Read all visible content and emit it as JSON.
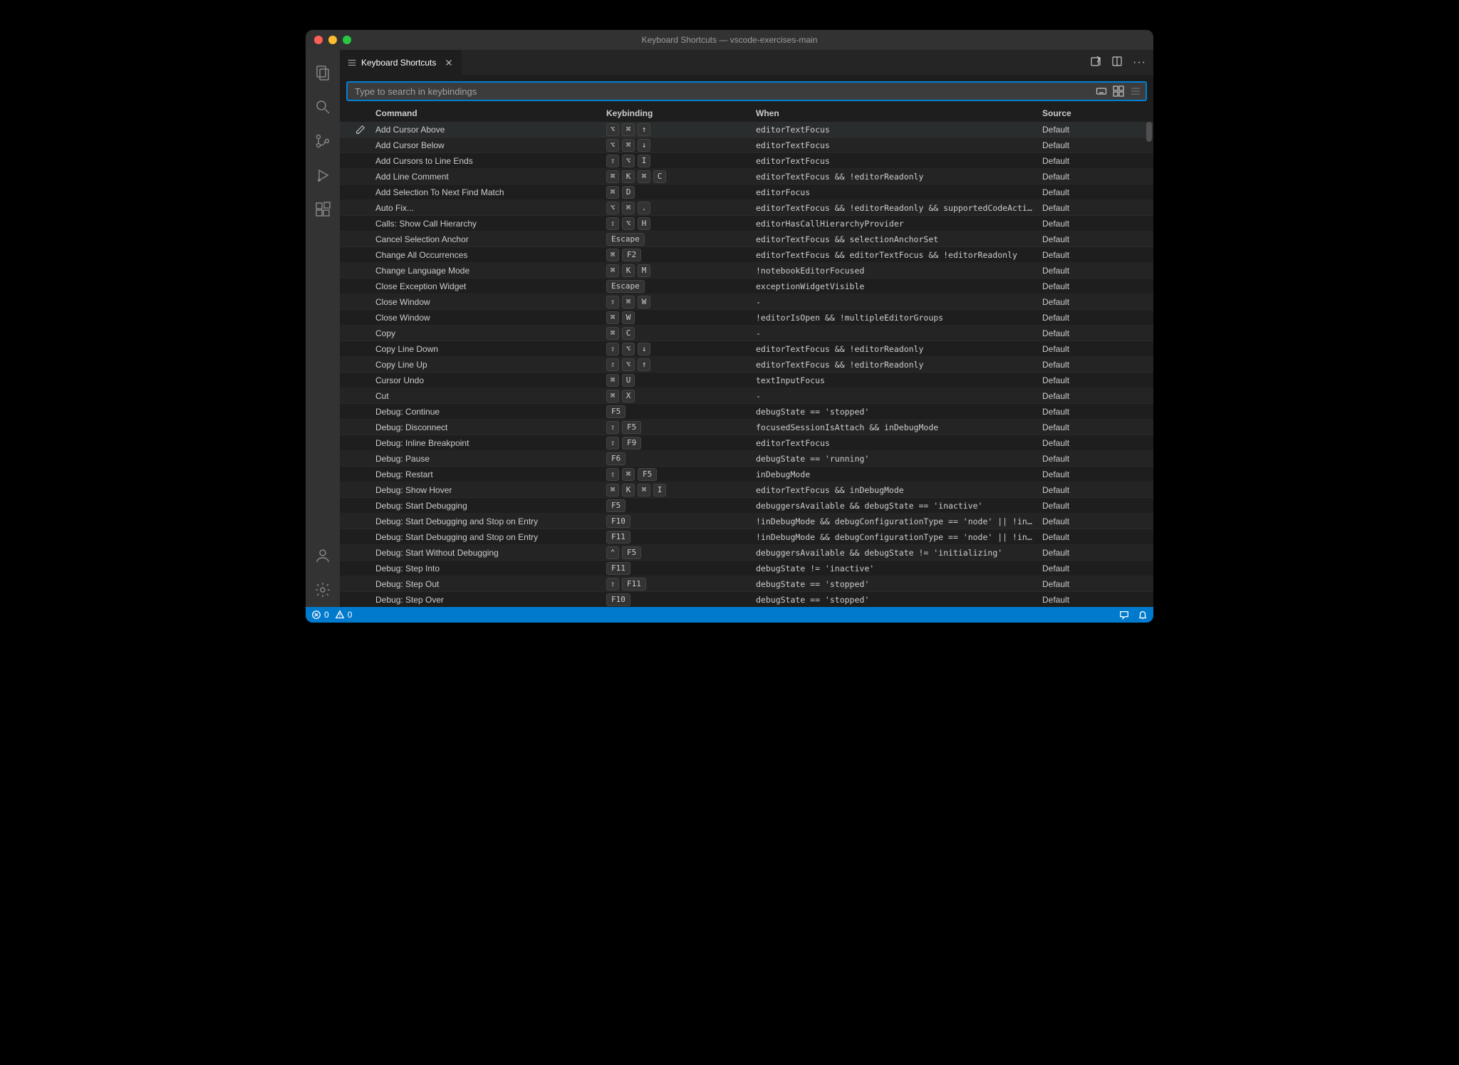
{
  "titlebar": {
    "title": "Keyboard Shortcuts — vscode-exercises-main"
  },
  "tab": {
    "label": "Keyboard Shortcuts"
  },
  "search": {
    "placeholder": "Type to search in keybindings"
  },
  "headers": {
    "command": "Command",
    "keybinding": "Keybinding",
    "when": "When",
    "source": "Source"
  },
  "statusbar": {
    "errors": "0",
    "warnings": "0"
  },
  "rows": [
    {
      "command": "Add Cursor Above",
      "keys": [
        "⌥",
        "⌘",
        "↑"
      ],
      "when": "editorTextFocus",
      "source": "Default",
      "selected": true
    },
    {
      "command": "Add Cursor Below",
      "keys": [
        "⌥",
        "⌘",
        "↓"
      ],
      "when": "editorTextFocus",
      "source": "Default"
    },
    {
      "command": "Add Cursors to Line Ends",
      "keys": [
        "⇧",
        "⌥",
        "I"
      ],
      "when": "editorTextFocus",
      "source": "Default"
    },
    {
      "command": "Add Line Comment",
      "keys": [
        "⌘",
        "K",
        "⌘",
        "C"
      ],
      "when": "editorTextFocus && !editorReadonly",
      "source": "Default"
    },
    {
      "command": "Add Selection To Next Find Match",
      "keys": [
        "⌘",
        "D"
      ],
      "when": "editorFocus",
      "source": "Default"
    },
    {
      "command": "Auto Fix...",
      "keys": [
        "⌥",
        "⌘",
        "."
      ],
      "when": "editorTextFocus && !editorReadonly && supportedCodeAction =~…",
      "source": "Default"
    },
    {
      "command": "Calls: Show Call Hierarchy",
      "keys": [
        "⇧",
        "⌥",
        "H"
      ],
      "when": "editorHasCallHierarchyProvider",
      "source": "Default"
    },
    {
      "command": "Cancel Selection Anchor",
      "keys": [
        "Escape"
      ],
      "when": "editorTextFocus && selectionAnchorSet",
      "source": "Default"
    },
    {
      "command": "Change All Occurrences",
      "keys": [
        "⌘",
        "F2"
      ],
      "when": "editorTextFocus && editorTextFocus && !editorReadonly",
      "source": "Default"
    },
    {
      "command": "Change Language Mode",
      "keys": [
        "⌘",
        "K",
        "M"
      ],
      "when": "!notebookEditorFocused",
      "source": "Default"
    },
    {
      "command": "Close Exception Widget",
      "keys": [
        "Escape"
      ],
      "when": "exceptionWidgetVisible",
      "source": "Default"
    },
    {
      "command": "Close Window",
      "keys": [
        "⇧",
        "⌘",
        "W"
      ],
      "when": "-",
      "source": "Default"
    },
    {
      "command": "Close Window",
      "keys": [
        "⌘",
        "W"
      ],
      "when": "!editorIsOpen && !multipleEditorGroups",
      "source": "Default"
    },
    {
      "command": "Copy",
      "keys": [
        "⌘",
        "C"
      ],
      "when": "-",
      "source": "Default"
    },
    {
      "command": "Copy Line Down",
      "keys": [
        "⇧",
        "⌥",
        "↓"
      ],
      "when": "editorTextFocus && !editorReadonly",
      "source": "Default"
    },
    {
      "command": "Copy Line Up",
      "keys": [
        "⇧",
        "⌥",
        "↑"
      ],
      "when": "editorTextFocus && !editorReadonly",
      "source": "Default"
    },
    {
      "command": "Cursor Undo",
      "keys": [
        "⌘",
        "U"
      ],
      "when": "textInputFocus",
      "source": "Default"
    },
    {
      "command": "Cut",
      "keys": [
        "⌘",
        "X"
      ],
      "when": "-",
      "source": "Default"
    },
    {
      "command": "Debug: Continue",
      "keys": [
        "F5"
      ],
      "when": "debugState == 'stopped'",
      "source": "Default"
    },
    {
      "command": "Debug: Disconnect",
      "keys": [
        "⇧",
        "F5"
      ],
      "when": "focusedSessionIsAttach && inDebugMode",
      "source": "Default"
    },
    {
      "command": "Debug: Inline Breakpoint",
      "keys": [
        "⇧",
        "F9"
      ],
      "when": "editorTextFocus",
      "source": "Default"
    },
    {
      "command": "Debug: Pause",
      "keys": [
        "F6"
      ],
      "when": "debugState == 'running'",
      "source": "Default"
    },
    {
      "command": "Debug: Restart",
      "keys": [
        "⇧",
        "⌘",
        "F5"
      ],
      "when": "inDebugMode",
      "source": "Default"
    },
    {
      "command": "Debug: Show Hover",
      "keys": [
        "⌘",
        "K",
        "⌘",
        "I"
      ],
      "when": "editorTextFocus && inDebugMode",
      "source": "Default"
    },
    {
      "command": "Debug: Start Debugging",
      "keys": [
        "F5"
      ],
      "when": "debuggersAvailable && debugState == 'inactive'",
      "source": "Default"
    },
    {
      "command": "Debug: Start Debugging and Stop on Entry",
      "keys": [
        "F10"
      ],
      "when": "!inDebugMode && debugConfigurationType == 'node' || !inDebug…",
      "source": "Default"
    },
    {
      "command": "Debug: Start Debugging and Stop on Entry",
      "keys": [
        "F11"
      ],
      "when": "!inDebugMode && debugConfigurationType == 'node' || !inDebug…",
      "source": "Default"
    },
    {
      "command": "Debug: Start Without Debugging",
      "keys": [
        "⌃",
        "F5"
      ],
      "when": "debuggersAvailable && debugState != 'initializing'",
      "source": "Default"
    },
    {
      "command": "Debug: Step Into",
      "keys": [
        "F11"
      ],
      "when": "debugState != 'inactive'",
      "source": "Default"
    },
    {
      "command": "Debug: Step Out",
      "keys": [
        "⇧",
        "F11"
      ],
      "when": "debugState == 'stopped'",
      "source": "Default"
    },
    {
      "command": "Debug: Step Over",
      "keys": [
        "F10"
      ],
      "when": "debugState == 'stopped'",
      "source": "Default"
    }
  ]
}
